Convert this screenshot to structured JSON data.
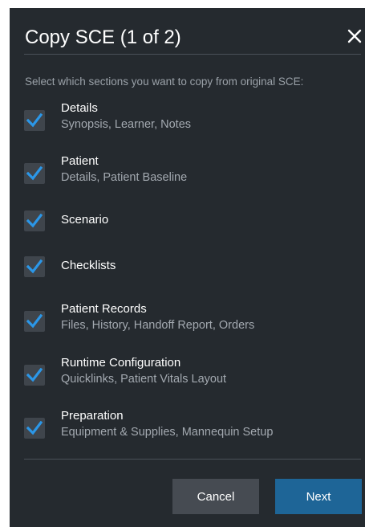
{
  "dialog": {
    "title": "Copy SCE (1 of 2)",
    "close_icon": "close-icon",
    "instruction": "Select which sections you want to copy from original SCE:"
  },
  "options": [
    {
      "label": "Details",
      "description": "Synopsis, Learner, Notes",
      "checked": true
    },
    {
      "label": "Patient",
      "description": "Details, Patient Baseline",
      "checked": true
    },
    {
      "label": "Scenario",
      "description": "",
      "checked": true
    },
    {
      "label": "Checklists",
      "description": "",
      "checked": true
    },
    {
      "label": "Patient Records",
      "description": "Files, History, Handoff Report, Orders",
      "checked": true
    },
    {
      "label": "Runtime Configuration",
      "description": "Quicklinks, Patient Vitals Layout",
      "checked": true
    },
    {
      "label": "Preparation",
      "description": "Equipment & Supplies, Mannequin Setup",
      "checked": true
    }
  ],
  "buttons": {
    "cancel": "Cancel",
    "next": "Next"
  },
  "colors": {
    "dialog_bg": "#252a2f",
    "checkbox_bg": "#3f454c",
    "checkmark": "#2b97e8",
    "next_button": "#1e6597",
    "cancel_button": "#464b52"
  }
}
